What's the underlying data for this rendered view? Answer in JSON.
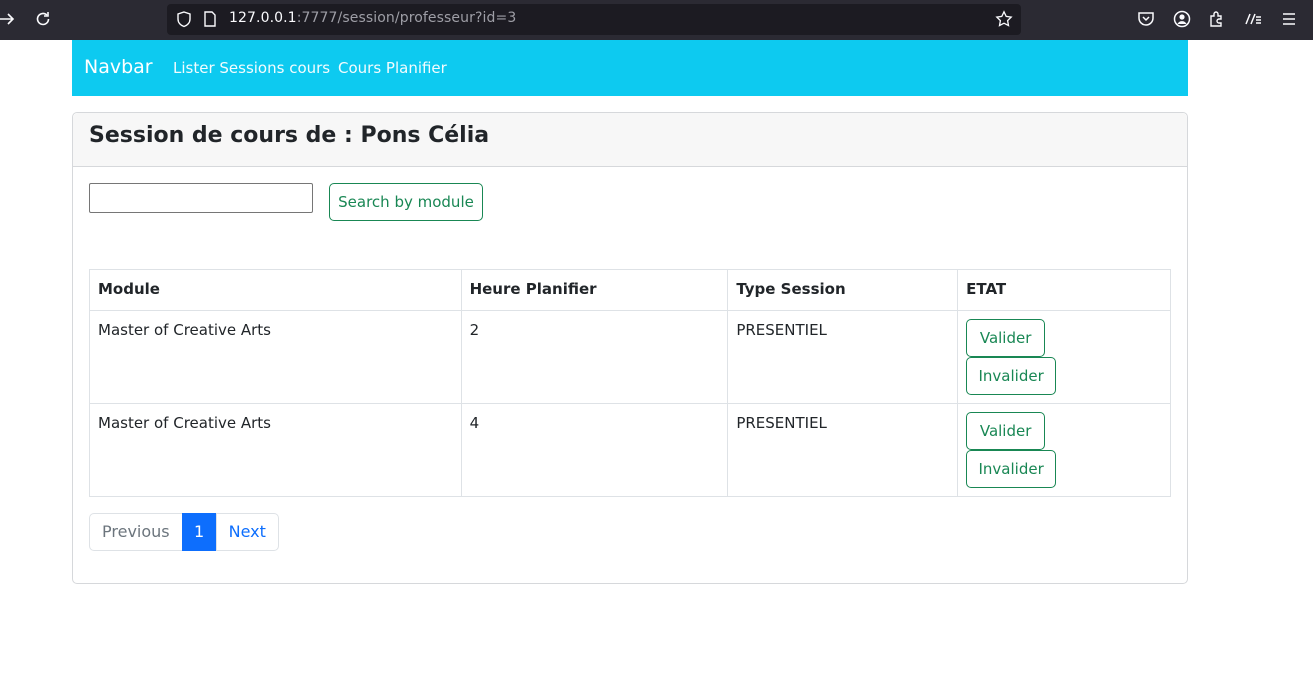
{
  "browser": {
    "url_host": "127.0.0.1",
    "url_rest": ":7777/session/professeur?id=3"
  },
  "navbar": {
    "brand": "Navbar",
    "links": [
      "Lister Sessions cours",
      "Cours Planifier"
    ]
  },
  "card": {
    "title": "Session de cours de : Pons Célia"
  },
  "search": {
    "value": "",
    "button_label": "Search by module"
  },
  "table": {
    "headers": [
      "Module",
      "Heure Planifier",
      "Type Session",
      "ETAT"
    ],
    "rows": [
      {
        "module": "Master of Creative Arts",
        "heure": "2",
        "type": "PRESENTIEL",
        "valider": "Valider",
        "invalider": "Invalider"
      },
      {
        "module": "Master of Creative Arts",
        "heure": "4",
        "type": "PRESENTIEL",
        "valider": "Valider",
        "invalider": "Invalider"
      }
    ]
  },
  "pagination": {
    "previous": "Previous",
    "current": "1",
    "next": "Next"
  },
  "colors": {
    "navbar_bg": "#0dcaf0",
    "success": "#198754",
    "primary": "#0d6efd"
  }
}
